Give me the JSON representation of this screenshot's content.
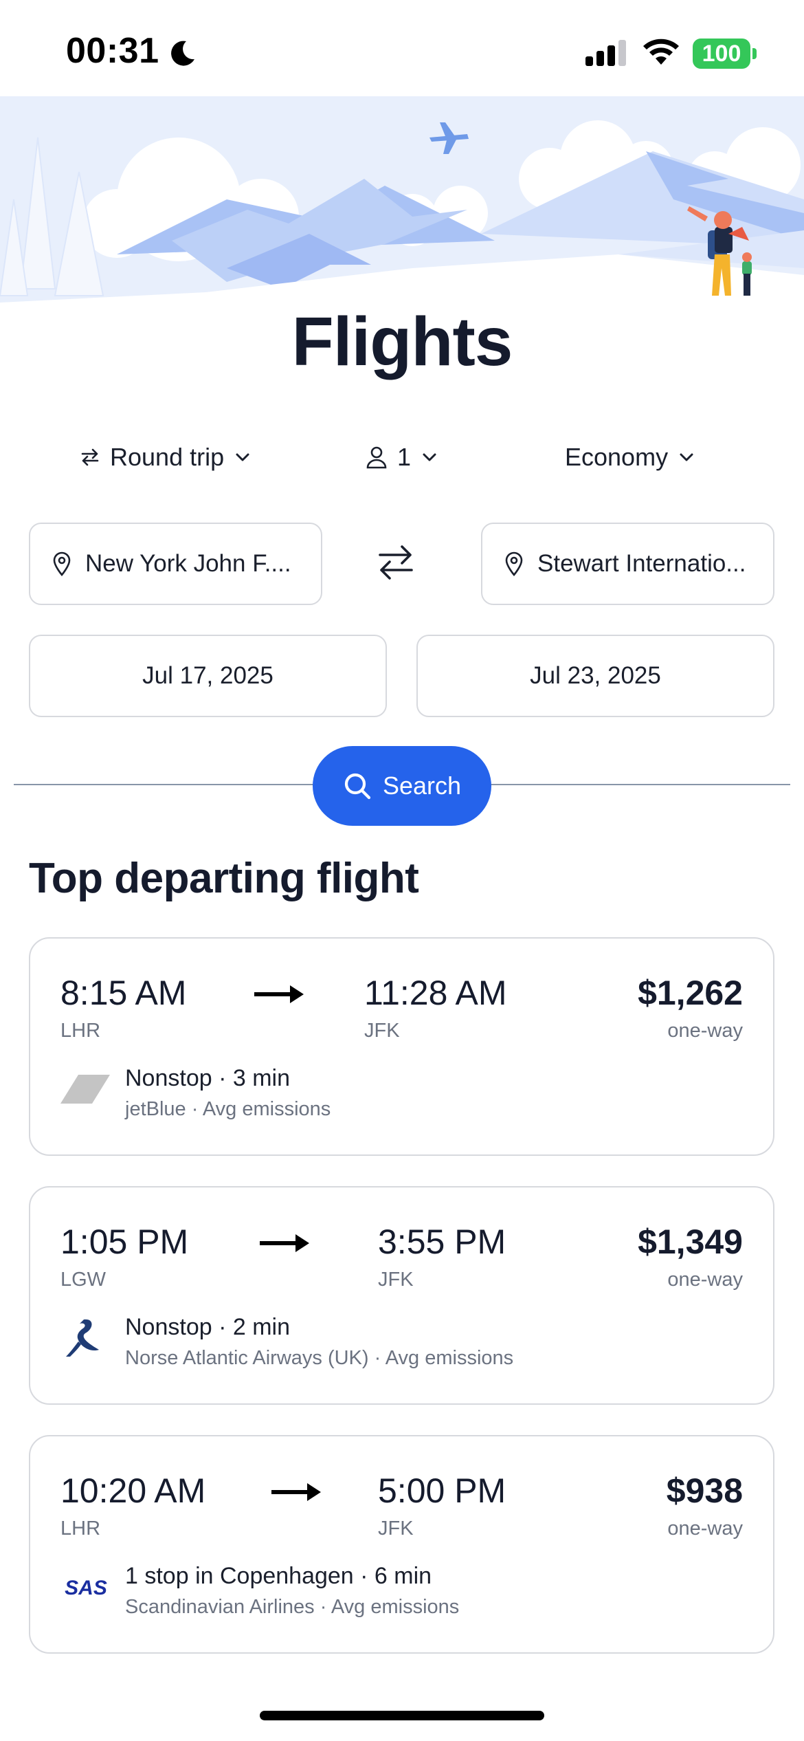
{
  "status": {
    "time": "00:31",
    "battery": "100"
  },
  "page": {
    "title": "Flights"
  },
  "options": {
    "trip_type": "Round trip",
    "passengers": "1",
    "cabin_class": "Economy"
  },
  "route": {
    "origin": "New York John F....",
    "destination": "Stewart Internatio..."
  },
  "dates": {
    "depart": "Jul 17, 2025",
    "return": "Jul 23, 2025"
  },
  "search": {
    "label": "Search"
  },
  "section": {
    "title": "Top departing flight"
  },
  "flights": [
    {
      "depart_time": "8:15 AM",
      "depart_code": "LHR",
      "arrive_time": "11:28 AM",
      "arrive_code": "JFK",
      "price": "$1,262",
      "price_note": "one-way",
      "summary": "Nonstop · 3 min",
      "details": "jetBlue · Avg emissions",
      "logo": "jetblue-logo"
    },
    {
      "depart_time": "1:05 PM",
      "depart_code": "LGW",
      "arrive_time": "3:55 PM",
      "arrive_code": "JFK",
      "price": "$1,349",
      "price_note": "one-way",
      "summary": "Nonstop · 2 min",
      "details": "Norse Atlantic Airways (UK) · Avg emissions",
      "logo": "norse-logo"
    },
    {
      "depart_time": "10:20 AM",
      "depart_code": "LHR",
      "arrive_time": "5:00 PM",
      "arrive_code": "JFK",
      "price": "$938",
      "price_note": "one-way",
      "summary": "1 stop in Copenhagen · 6 min",
      "details": "Scandinavian Airlines · Avg emissions",
      "logo": "sas-logo",
      "logo_text": "SAS"
    }
  ],
  "colors": {
    "primary": "#2563eb",
    "battery": "#34c759",
    "hero_bg": "#e8effc",
    "text": "#151b2d",
    "muted": "#6b7280"
  }
}
